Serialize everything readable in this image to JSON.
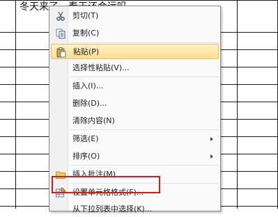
{
  "sheet": {
    "cell_text": "冬天来了，春天还会远吗"
  },
  "menu": {
    "items": [
      {
        "label": "剪切(T)",
        "icon": "scissors-icon"
      },
      {
        "label": "复制(C)",
        "icon": "copy-icon"
      },
      {
        "label": "粘贴(P)",
        "icon": "paste-icon",
        "highlighted": true
      },
      {
        "label": "选择性粘贴(V)..."
      },
      {
        "label": "插入(I)..."
      },
      {
        "label": "删除(D)..."
      },
      {
        "label": "清除内容(N)"
      },
      {
        "label": "筛选(E)",
        "submenu": true
      },
      {
        "label": "排序(O)",
        "submenu": true
      },
      {
        "label": "插入批注(M)",
        "icon": "comment-icon"
      },
      {
        "label": "设置单元格格式(F)...",
        "icon": "format-cells-icon",
        "outlined": true
      },
      {
        "label": "从下拉列表中选择(K)..."
      }
    ]
  },
  "colors": {
    "highlight": "#fbdf8f",
    "outline": "#cc1f1f"
  }
}
